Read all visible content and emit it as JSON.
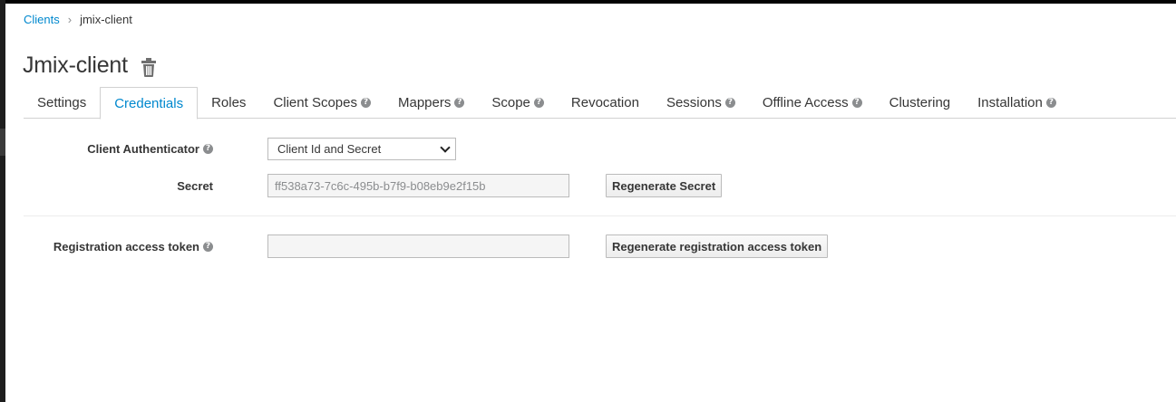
{
  "breadcrumb": {
    "root": "Clients",
    "separator": "›",
    "current": "jmix-client"
  },
  "page": {
    "title": "Jmix-client"
  },
  "tabs": [
    {
      "label": "Settings",
      "help": false
    },
    {
      "label": "Credentials",
      "help": false,
      "active": true
    },
    {
      "label": "Roles",
      "help": false
    },
    {
      "label": "Client Scopes",
      "help": true
    },
    {
      "label": "Mappers",
      "help": true
    },
    {
      "label": "Scope",
      "help": true
    },
    {
      "label": "Revocation",
      "help": false
    },
    {
      "label": "Sessions",
      "help": true
    },
    {
      "label": "Offline Access",
      "help": true
    },
    {
      "label": "Clustering",
      "help": false
    },
    {
      "label": "Installation",
      "help": true
    }
  ],
  "form": {
    "authenticator_label": "Client Authenticator",
    "authenticator_value": "Client Id and Secret",
    "secret_label": "Secret",
    "secret_value": "ff538a73-7c6c-495b-b7f9-b08eb9e2f15b",
    "regenerate_secret_label": "Regenerate Secret",
    "token_label": "Registration access token",
    "token_value": "",
    "regenerate_token_label": "Regenerate registration access token"
  },
  "icons": {
    "help": "help-icon",
    "delete": "trash-icon",
    "dropdown": "chevron-down-icon"
  },
  "colors": {
    "accent": "#0088ce",
    "text": "#363636",
    "muted": "#8b8d8f",
    "border": "#d1d1d1"
  }
}
